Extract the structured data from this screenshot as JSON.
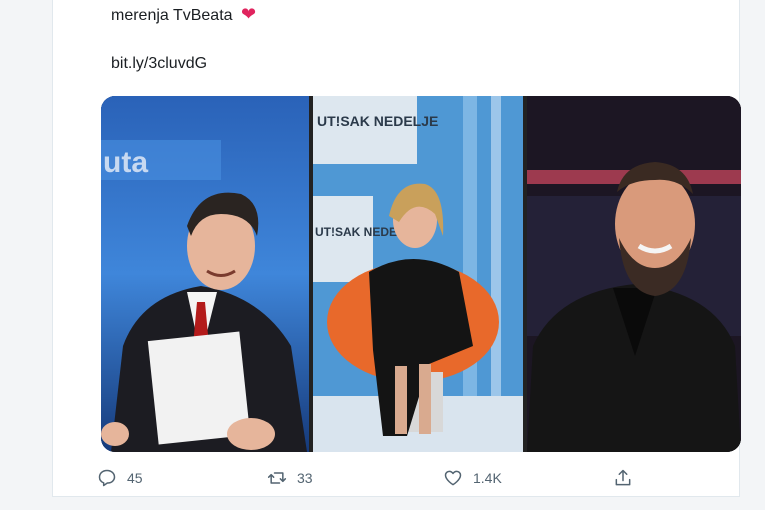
{
  "tweet": {
    "text_line": "merenja TvBeata",
    "link": "bit.ly/3cluvdG",
    "emoji": "❤"
  },
  "media": {
    "overlay_texts": [
      "uta",
      "UT!SAK NEDELJE",
      "UT!SAK NEDELJE"
    ]
  },
  "actions": {
    "reply_count": "45",
    "retweet_count": "33",
    "like_count": "1.4K"
  },
  "icons": {
    "reply": "reply-icon",
    "retweet": "retweet-icon",
    "like": "heart-icon",
    "share": "share-icon"
  },
  "colors": {
    "heart": "#e0245e",
    "muted": "#536471"
  }
}
